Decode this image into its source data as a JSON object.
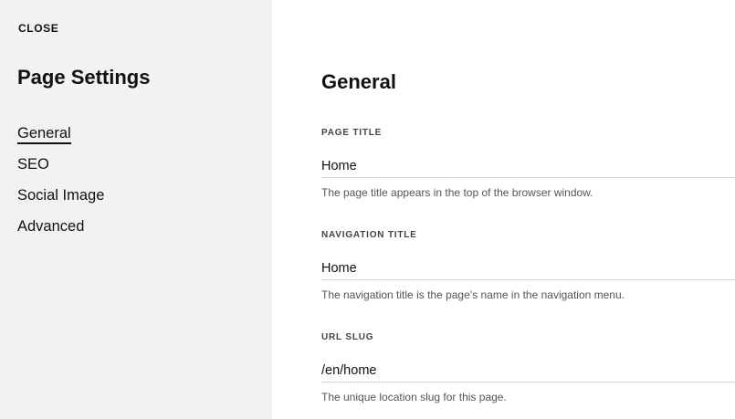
{
  "sidebar": {
    "close_label": "CLOSE",
    "title": "Page Settings",
    "items": [
      {
        "label": "General",
        "active": true
      },
      {
        "label": "SEO",
        "active": false
      },
      {
        "label": "Social Image",
        "active": false
      },
      {
        "label": "Advanced",
        "active": false
      }
    ]
  },
  "main": {
    "title": "General",
    "fields": [
      {
        "label": "PAGE TITLE",
        "value": "Home",
        "help": "The page title appears in the top of the browser window."
      },
      {
        "label": "NAVIGATION TITLE",
        "value": "Home",
        "help": "The navigation title is the page’s name in the navigation menu."
      },
      {
        "label": "URL SLUG",
        "value": "/en/home",
        "help": "The unique location slug for this page."
      }
    ]
  }
}
